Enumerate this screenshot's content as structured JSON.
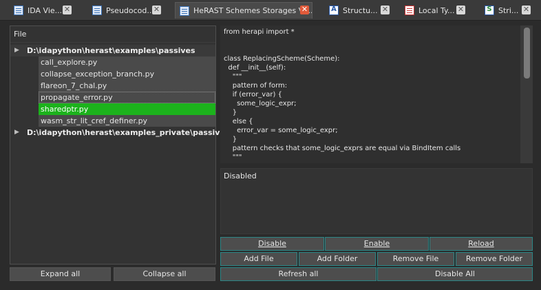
{
  "tabs": [
    {
      "label": "IDA Vie...",
      "icon": "document-icon",
      "active": false
    },
    {
      "label": "Pseudocod...",
      "icon": "document-icon",
      "active": false
    },
    {
      "label": "HeRAST Schemes Storages Vi...",
      "icon": "document-icon",
      "active": true
    },
    {
      "label": "Structu...",
      "icon": "structures-icon",
      "active": false
    },
    {
      "label": "Local Ty...",
      "icon": "local-types-icon",
      "active": false
    },
    {
      "label": "Stri...",
      "icon": "strings-icon",
      "active": false
    }
  ],
  "tree": {
    "header": "File",
    "folders": [
      {
        "name": "D:\\idapython\\herast\\examples\\passives",
        "expanded": true
      },
      {
        "name": "D:\\idapython\\herast\\examples_private\\passives",
        "expanded": false
      }
    ],
    "files": [
      "call_explore.py",
      "collapse_exception_branch.py",
      "flareon_7_chal.py",
      "propagate_error.py",
      "sharedptr.py",
      "wasm_str_lit_cref_definer.py"
    ],
    "selected_file": "sharedptr.py",
    "focused_file": "propagate_error.py"
  },
  "left_buttons": {
    "expand_all": "Expand all",
    "collapse_all": "Collapse all"
  },
  "code": {
    "lines": [
      "from herapi import *",
      "",
      "",
      "class ReplacingScheme(Scheme):",
      "  def __init__(self):",
      "    \"\"\"",
      "    pattern of form:",
      "    if (error_var) {",
      "      some_logic_expr;",
      "    }",
      "    else {",
      "      error_var = some_logic_expr;",
      "    }",
      "    pattern checks that some_logic_exprs are equal via BindItem calls",
      "    \"\"\"",
      "                    "
    ]
  },
  "status": {
    "text": "Disabled"
  },
  "buttons": {
    "disable": "Disable",
    "enable": "Enable",
    "reload": "Reload",
    "add_file": "Add File",
    "add_folder": "Add Folder",
    "remove_file": "Remove File",
    "remove_folder": "Remove Folder",
    "refresh_all": "Refresh all",
    "disable_all": "Disable All"
  },
  "colors": {
    "selected_row": "#1cb21c",
    "button_border": "#2c8686",
    "active_tab_close": "#e05a3a"
  }
}
